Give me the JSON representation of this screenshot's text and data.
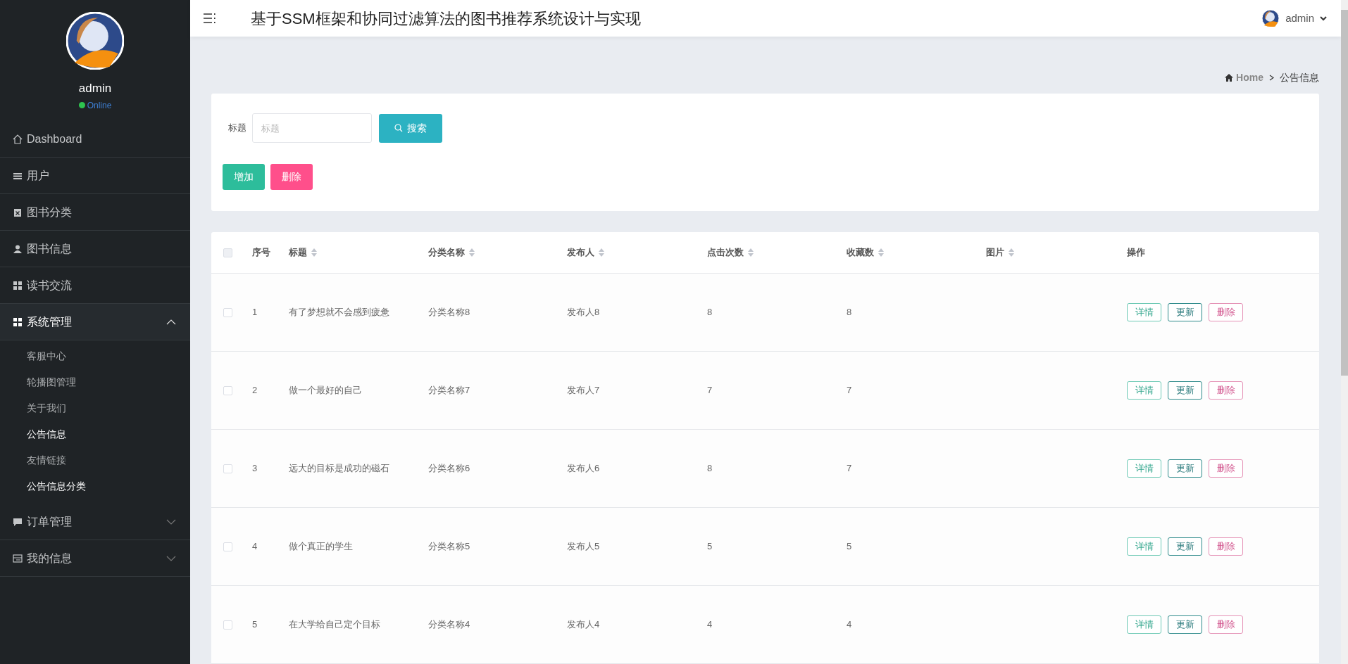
{
  "sidebar": {
    "user": {
      "name": "admin",
      "status": "Online",
      "online": true
    },
    "items": [
      {
        "kind": "link",
        "label": "Dashboard"
      },
      {
        "kind": "link",
        "label": "用户"
      },
      {
        "kind": "link",
        "label": "图书分类"
      },
      {
        "kind": "link",
        "label": "图书信息"
      },
      {
        "kind": "link",
        "label": "读书交流"
      },
      {
        "kind": "group",
        "label": "系统管理",
        "expanded": true,
        "children": [
          {
            "label": "客服中心",
            "selected": false
          },
          {
            "label": "轮播图管理",
            "selected": false
          },
          {
            "label": "关于我们",
            "selected": false
          },
          {
            "label": "公告信息",
            "selected": true
          },
          {
            "label": "友情链接",
            "selected": false
          },
          {
            "label": "公告信息分类",
            "selected": true
          }
        ]
      },
      {
        "kind": "group",
        "label": "订单管理",
        "expanded": false
      },
      {
        "kind": "group",
        "label": "我的信息",
        "expanded": false
      }
    ]
  },
  "header": {
    "title": "基于SSM框架和协同过滤算法的图书推荐系统设计与实现",
    "user": "admin"
  },
  "breadcrumb": [
    "Home",
    "公告信息"
  ],
  "search": {
    "label": "标题",
    "placeholder": "标题",
    "button": "搜索"
  },
  "actions": [
    {
      "label": "增加",
      "kind": "add"
    },
    {
      "label": "删除",
      "kind": "delete"
    }
  ],
  "table": {
    "select_all": {
      "checked": false
    },
    "columns": [
      {
        "label": "序号",
        "sortable": false
      },
      {
        "label": "标题",
        "sortable": true
      },
      {
        "label": "分类名称",
        "sortable": true
      },
      {
        "label": "发布人",
        "sortable": true
      },
      {
        "label": "点击次数",
        "sortable": true
      },
      {
        "label": "收藏数",
        "sortable": true
      },
      {
        "label": "图片",
        "sortable": true
      },
      {
        "label": "操作",
        "sortable": false
      }
    ],
    "rows": [
      {
        "checked": false,
        "cells": [
          "1",
          "有了梦想就不会感到疲惫",
          "分类名称8",
          "发布人8",
          "8",
          "8"
        ],
        "actions": [
          "详情",
          "更新",
          "删除"
        ]
      },
      {
        "checked": false,
        "cells": [
          "2",
          "做一个最好的自己",
          "分类名称7",
          "发布人7",
          "7",
          "7"
        ],
        "actions": [
          "详情",
          "更新",
          "删除"
        ]
      },
      {
        "checked": false,
        "cells": [
          "3",
          "远大的目标是成功的磁石",
          "分类名称6",
          "发布人6",
          "8",
          "7"
        ],
        "actions": [
          "详情",
          "更新",
          "删除"
        ]
      },
      {
        "checked": false,
        "cells": [
          "4",
          "做个真正的学生",
          "分类名称5",
          "发布人5",
          "5",
          "5"
        ],
        "actions": [
          "详情",
          "更新",
          "删除"
        ]
      },
      {
        "checked": false,
        "cells": [
          "5",
          "在大学给自己定个目标",
          "分类名称4",
          "发布人4",
          "4",
          "4"
        ],
        "actions": [
          "详情",
          "更新",
          "删除"
        ]
      }
    ]
  }
}
